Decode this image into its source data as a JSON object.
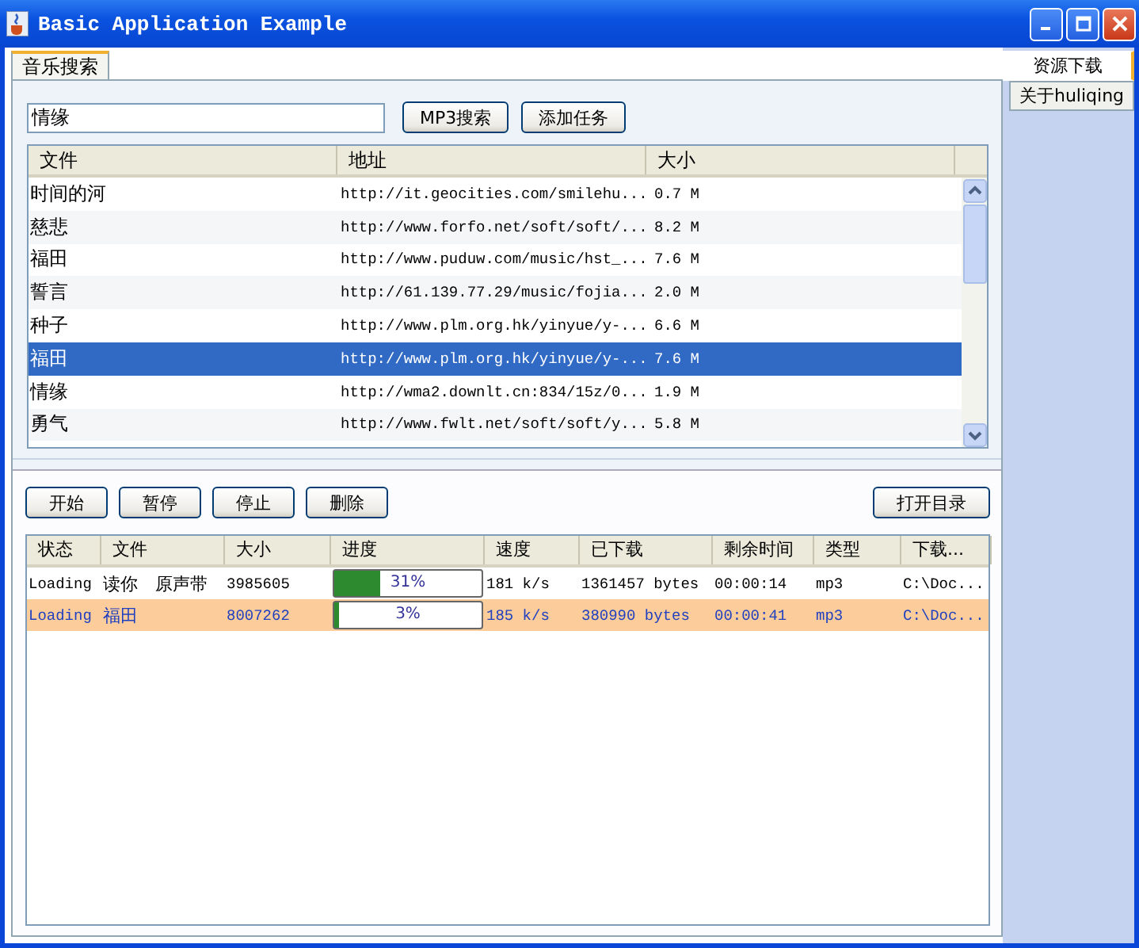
{
  "window": {
    "title": "Basic Application Example"
  },
  "tabs": [
    {
      "label": "音乐搜索",
      "selected": true
    }
  ],
  "side_tabs": [
    {
      "label": "资源下载",
      "selected": true
    },
    {
      "label": "关于huliqing",
      "selected": false
    }
  ],
  "search": {
    "value": "情缘",
    "buttons": [
      "MP3搜索",
      "添加任务"
    ]
  },
  "results": {
    "columns": [
      "文件",
      "地址",
      "大小"
    ],
    "rows": [
      {
        "cells": [
          "时间的河",
          "http://it.geocities.com/smilehu...",
          "0.7 M"
        ],
        "selected": false
      },
      {
        "cells": [
          "慈悲",
          "http://www.forfo.net/soft/soft/...",
          "8.2 M"
        ],
        "selected": false
      },
      {
        "cells": [
          "福田",
          "http://www.puduw.com/music/hst_...",
          "7.6 M"
        ],
        "selected": false
      },
      {
        "cells": [
          "誓言",
          "http://61.139.77.29/music/fojia...",
          "2.0 M"
        ],
        "selected": false
      },
      {
        "cells": [
          "种子",
          "http://www.plm.org.hk/yinyue/y-...",
          "6.6 M"
        ],
        "selected": false
      },
      {
        "cells": [
          "福田",
          "http://www.plm.org.hk/yinyue/y-...",
          "7.6 M"
        ],
        "selected": true
      },
      {
        "cells": [
          "情缘",
          "http://wma2.downlt.cn:834/15z/0...",
          "1.9 M"
        ],
        "selected": false
      },
      {
        "cells": [
          "勇气",
          "http://www.fwlt.net/soft/soft/y...",
          "5.8 M"
        ],
        "selected": false
      }
    ]
  },
  "controls": {
    "left": [
      "开始",
      "暂停",
      "停止",
      "删除"
    ],
    "right": "打开目录"
  },
  "downloads": {
    "columns": [
      "状态",
      "文件",
      "大小",
      "进度",
      "速度",
      "已下载",
      "剩余时间",
      "类型",
      "下载..."
    ],
    "rows": [
      {
        "status": "Loading",
        "file": "读你　原声带",
        "size": "3985605",
        "level": 0.31,
        "progress": "31%",
        "speed": "181 k/s",
        "downloaded": "1361457 bytes",
        "remaining": "00:00:14",
        "type": "mp3",
        "path": "C:\\Doc...",
        "selected": false
      },
      {
        "status": "Loading",
        "file": "福田",
        "size": "8007262",
        "level": 0.03,
        "progress": "3%",
        "speed": "185 k/s",
        "downloaded": "380990 bytes",
        "remaining": "00:00:41",
        "type": "mp3",
        "path": "C:\\Doc...",
        "selected": true
      }
    ]
  }
}
